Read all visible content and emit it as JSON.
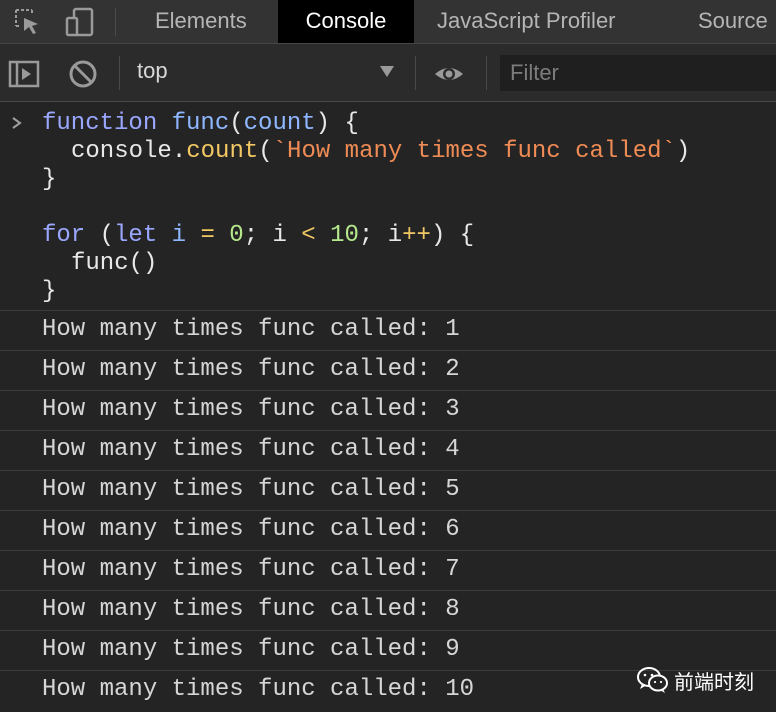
{
  "tabs": [
    "Elements",
    "Console",
    "JavaScript Profiler",
    "Source"
  ],
  "active_tab": "Console",
  "toolbar": {
    "context_value": "top",
    "filter_placeholder": "Filter"
  },
  "code": {
    "l1": {
      "kw": "function",
      "name": "func",
      "p1": "(",
      "param": "count",
      "p2": ") {"
    },
    "l2": {
      "obj": "console",
      "dot": ".",
      "method": "count",
      "p1": "(",
      "str": "`How many times func called`",
      "p2": ")"
    },
    "l3": "}",
    "l5": {
      "kw": "for",
      "p1": " (",
      "kw2": "let",
      "sp": " ",
      "v1": "i",
      "op1": " = ",
      "n0": "0",
      "p2": "; i ",
      "op2": "<",
      "sp2": " ",
      "n10": "10",
      "p3": "; i",
      "op3": "++",
      "p4": ") {"
    },
    "l6": "func()",
    "l7": "}"
  },
  "logs": [
    "How many times func called: 1",
    "How many times func called: 2",
    "How many times func called: 3",
    "How many times func called: 4",
    "How many times func called: 5",
    "How many times func called: 6",
    "How many times func called: 7",
    "How many times func called: 8",
    "How many times func called: 9",
    "How many times func called: 10"
  ],
  "watermark": {
    "text": "前端时刻"
  },
  "icons": [
    "inspect-element-icon",
    "device-toolbar-icon",
    "sidebar-toggle-icon",
    "clear-console-icon",
    "eye-icon",
    "prompt-chevron-icon",
    "wechat-icon"
  ]
}
